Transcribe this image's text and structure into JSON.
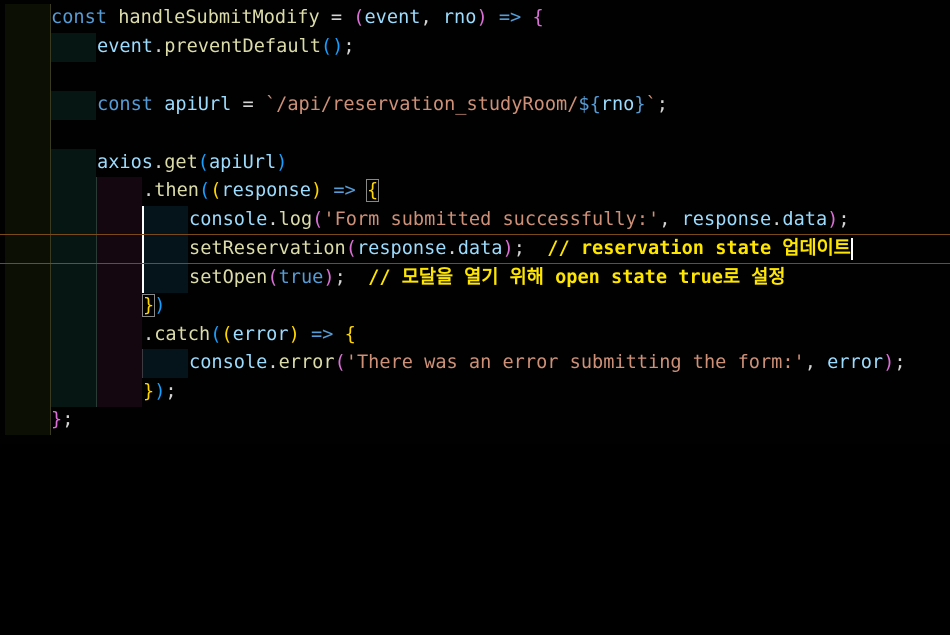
{
  "editor": {
    "lines": [
      {
        "text": "const handleSubmitModify = (event, rno) => {"
      },
      {
        "text": "    event.preventDefault();"
      },
      {
        "text": ""
      },
      {
        "text": "    const apiUrl = `/api/reservation_studyRoom/${rno}`;"
      },
      {
        "text": ""
      },
      {
        "text": "    axios.get(apiUrl)"
      },
      {
        "text": "        .then((response) => {"
      },
      {
        "text": "            console.log('Form submitted successfully:', response.data);"
      },
      {
        "text": "            setReservation(response.data);  // reservation state 업데이트"
      },
      {
        "text": "            setOpen(true);  // 모달을 열기 위해 open state true로 설정"
      },
      {
        "text": "        })"
      },
      {
        "text": "        .catch((error) => {"
      },
      {
        "text": "            console.error('There was an error submitting the form:', error);"
      },
      {
        "text": "        });"
      },
      {
        "text": "};"
      }
    ]
  },
  "tokens": {
    "l1": [
      "const",
      " ",
      "handleSubmitModify",
      " = ",
      "(",
      "event",
      ", ",
      "rno",
      ")",
      " => ",
      "{"
    ],
    "l2": [
      "event",
      ".",
      "preventDefault",
      "(",
      ")",
      ";"
    ],
    "l4": [
      "const",
      " ",
      "apiUrl",
      " = ",
      "`/api/reservation_studyRoom/",
      "${",
      "rno",
      "}",
      "`",
      ";"
    ],
    "l6": [
      "axios",
      ".",
      "get",
      "(",
      "apiUrl",
      ")"
    ],
    "l7": [
      ".",
      "then",
      "(",
      "(",
      "response",
      ")",
      " => ",
      "{"
    ],
    "l8": [
      "console",
      ".",
      "log",
      "(",
      "'Form submitted successfully:'",
      ", ",
      "response",
      ".",
      "data",
      ")",
      ";"
    ],
    "l9": [
      "setReservation",
      "(",
      "response",
      ".",
      "data",
      ")",
      ";",
      "  // reservation state 업데이트"
    ],
    "l10": [
      "setOpen",
      "(",
      "true",
      ")",
      ";",
      "  // 모달을 열기 위해 open state true로 설정"
    ],
    "l11": [
      "}",
      ")"
    ],
    "l12": [
      ".",
      "catch",
      "(",
      "(",
      "error",
      ")",
      " => ",
      "{"
    ],
    "l13": [
      "console",
      ".",
      "error",
      "(",
      "'There was an error submitting the form:'",
      ", ",
      "error",
      ")",
      ";"
    ],
    "l14": [
      "}",
      ")",
      ";"
    ],
    "l15": [
      "}",
      ";"
    ]
  }
}
